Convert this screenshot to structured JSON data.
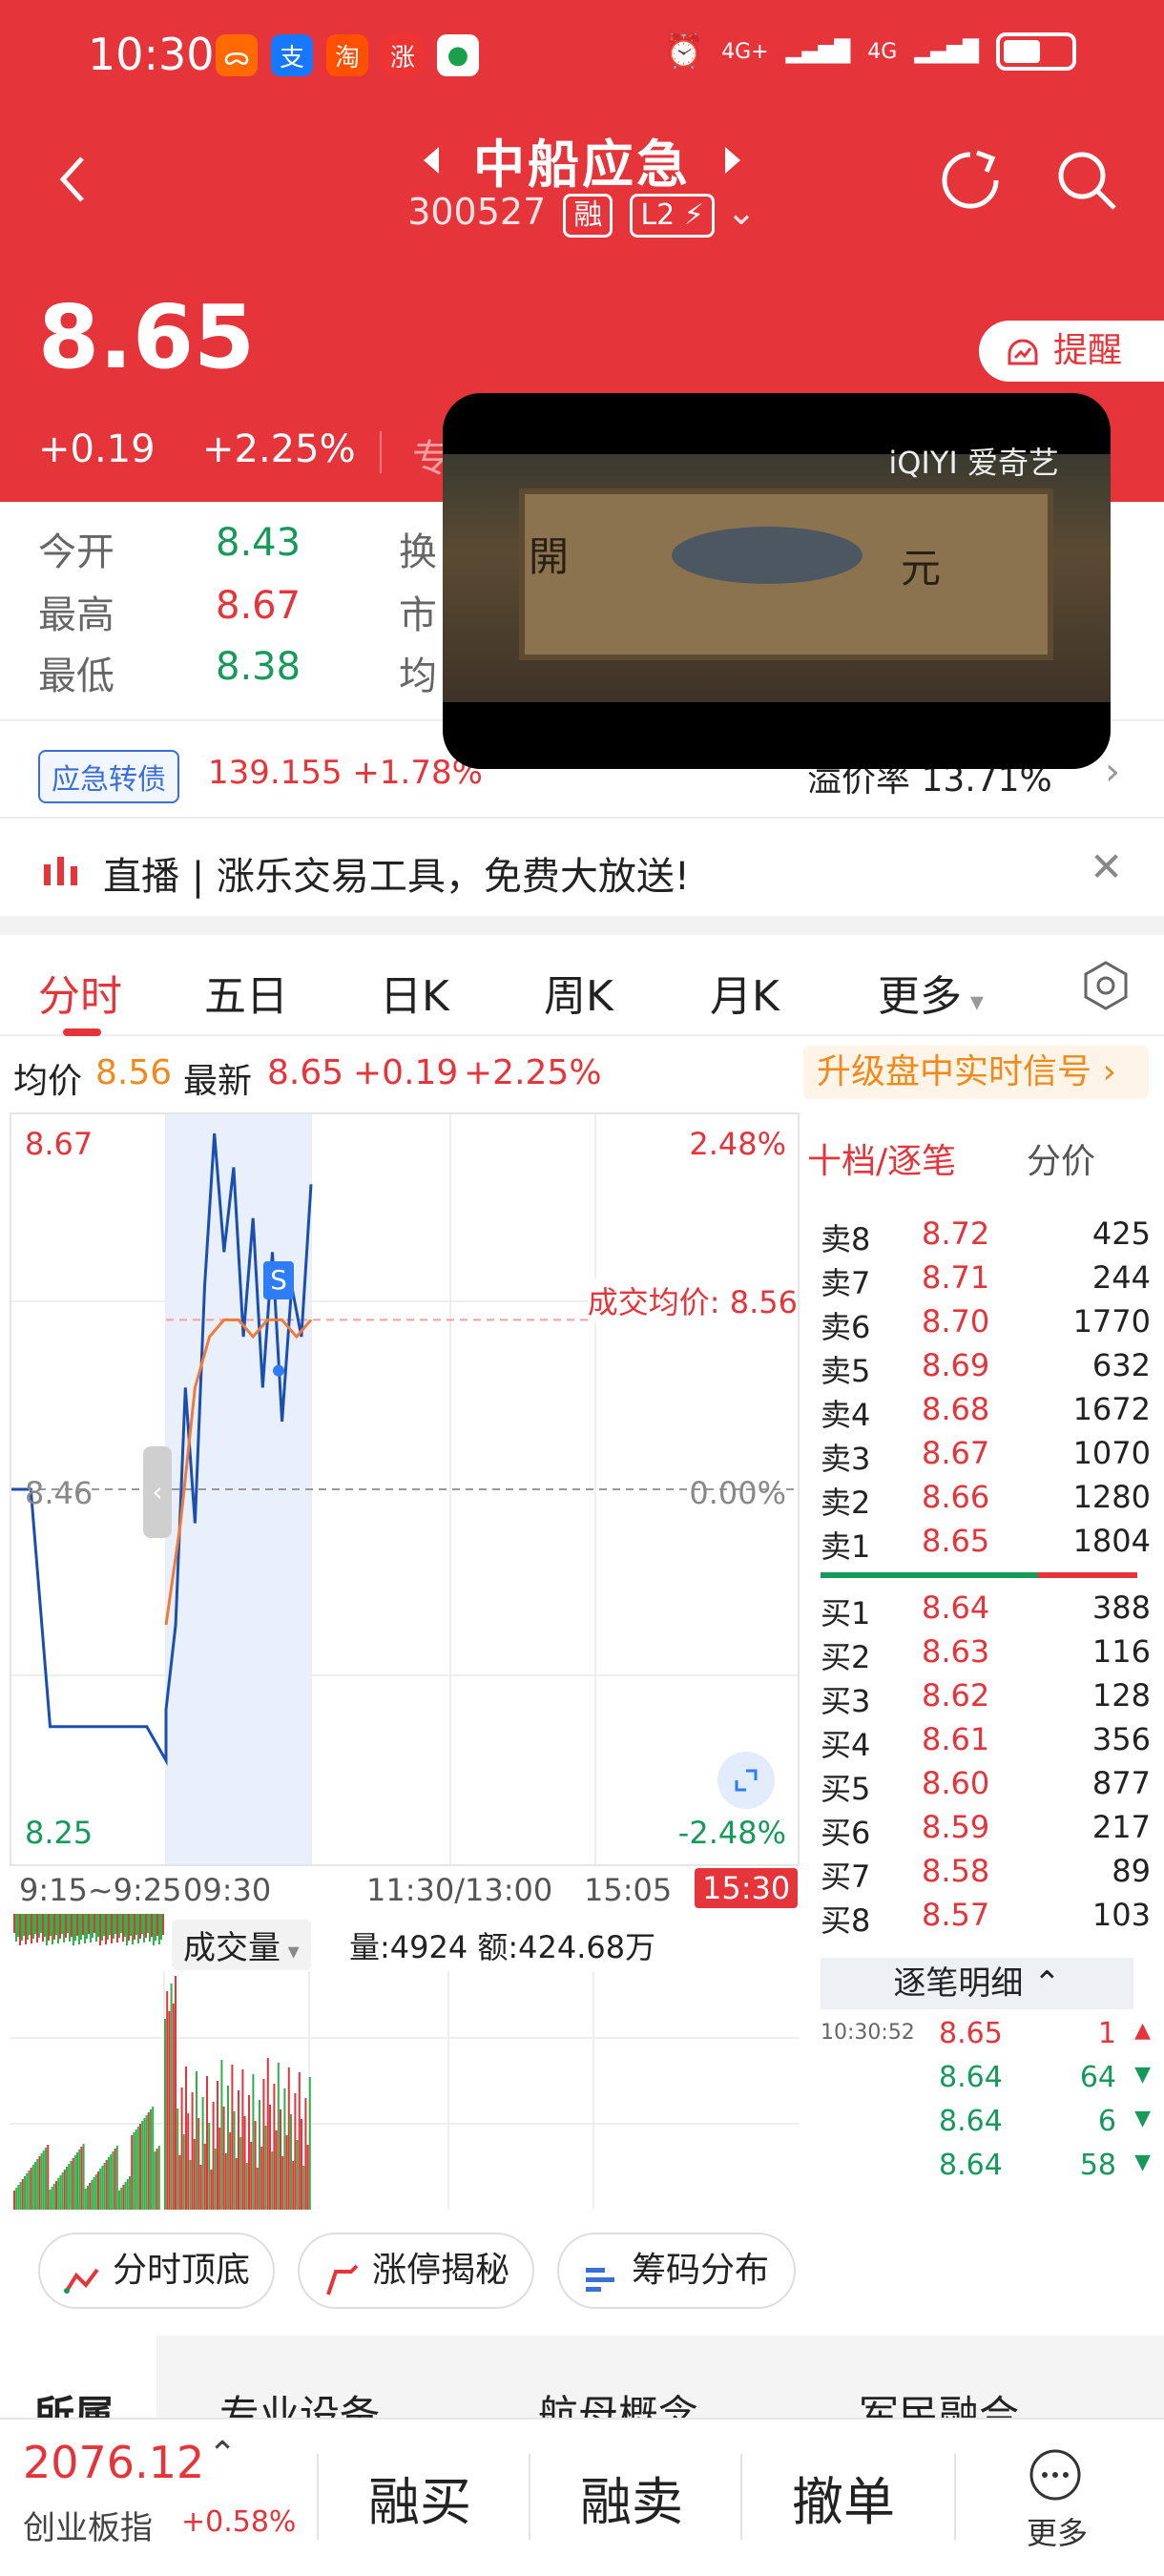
{
  "status_bar": {
    "time": "10:30",
    "net1": "4G+",
    "net2": "4G",
    "apps": [
      "app-a",
      "支",
      "淘",
      "涨",
      "app-e"
    ]
  },
  "header": {
    "title": "中船应急",
    "code": "300527",
    "tag_margin": "融",
    "tag_level": "L2",
    "price": "8.65",
    "change": "+0.19",
    "change_pct": "+2.25%",
    "partial_text": "专",
    "remind_label": "提醒"
  },
  "stats": {
    "open_label": "今开",
    "open": "8.43",
    "high_label": "最高",
    "high": "8.67",
    "low_label": "最低",
    "low": "8.38",
    "col2_1": "换",
    "col2_2": "市",
    "col2_3": "均"
  },
  "bond": {
    "tag": "应急转债",
    "price": "139.155",
    "pct": "+1.78%",
    "premium": "溢价率 13.71%"
  },
  "live_banner": {
    "text": "直播 | 涨乐交易工具，免费大放送!"
  },
  "video_overlay": {
    "brand": "iQIYI 爱奇艺",
    "chars": [
      "開",
      "元"
    ]
  },
  "chart_tabs": [
    "分时",
    "五日",
    "日K",
    "周K",
    "月K",
    "更多"
  ],
  "chart_info": {
    "avg_label": "均价",
    "avg": "8.56",
    "latest_label": "最新",
    "latest": "8.65",
    "chg": "+0.19",
    "chg_pct": "+2.25%",
    "upgrade": "升级盘中实时信号",
    "top_price": "8.67",
    "top_pct": "2.48%",
    "mid_price": "8.46",
    "mid_pct": "0.00%",
    "bot_price": "8.25",
    "bot_pct": "-2.48%",
    "avg_annot": "成交均价: 8.56",
    "signal": "S",
    "times": [
      "9:15~9:25",
      "09:30",
      "11:30/13:00",
      "15:05",
      "15:30"
    ],
    "vol_label": "成交量",
    "vol_text": "量:4924 额:424.68万"
  },
  "chart_data": {
    "type": "line",
    "ylim": [
      8.25,
      8.67
    ],
    "series": [
      {
        "values": [
          8.46,
          8.46,
          8.32,
          8.32,
          8.32,
          8.32,
          8.32,
          8.32,
          8.3,
          8.33,
          8.38,
          8.52,
          8.44,
          8.58,
          8.67,
          8.6,
          8.65,
          8.55,
          8.62,
          8.52,
          8.6,
          8.5,
          8.58,
          8.55,
          8.64
        ]
      },
      {
        "values": [
          8.38,
          8.44,
          8.52,
          8.55,
          8.56,
          8.56,
          8.55,
          8.56,
          8.56,
          8.55,
          8.56
        ]
      }
    ]
  },
  "order_book": {
    "header_left": "十档/逐笔",
    "header_right": "分价",
    "asks": [
      {
        "k": "卖8",
        "p": "8.72",
        "v": "425"
      },
      {
        "k": "卖7",
        "p": "8.71",
        "v": "244"
      },
      {
        "k": "卖6",
        "p": "8.70",
        "v": "1770"
      },
      {
        "k": "卖5",
        "p": "8.69",
        "v": "632"
      },
      {
        "k": "卖4",
        "p": "8.68",
        "v": "1672"
      },
      {
        "k": "卖3",
        "p": "8.67",
        "v": "1070"
      },
      {
        "k": "卖2",
        "p": "8.66",
        "v": "1280"
      },
      {
        "k": "卖1",
        "p": "8.65",
        "v": "1804"
      }
    ],
    "bids": [
      {
        "k": "买1",
        "p": "8.64",
        "v": "388"
      },
      {
        "k": "买2",
        "p": "8.63",
        "v": "116"
      },
      {
        "k": "买3",
        "p": "8.62",
        "v": "128"
      },
      {
        "k": "买4",
        "p": "8.61",
        "v": "356"
      },
      {
        "k": "买5",
        "p": "8.60",
        "v": "877"
      },
      {
        "k": "买6",
        "p": "8.59",
        "v": "217"
      },
      {
        "k": "买7",
        "p": "8.58",
        "v": "89"
      },
      {
        "k": "买8",
        "p": "8.57",
        "v": "103"
      }
    ],
    "ticks_label": "逐笔明细",
    "ticks": [
      {
        "t": "10:30:52",
        "p": "8.65",
        "v": "1",
        "dir": "up"
      },
      {
        "t": "",
        "p": "8.64",
        "v": "64",
        "dir": "down"
      },
      {
        "t": "",
        "p": "8.64",
        "v": "6",
        "dir": "down"
      },
      {
        "t": "",
        "p": "8.64",
        "v": "58",
        "dir": "down"
      }
    ]
  },
  "tool_buttons": [
    "分时顶底",
    "涨停揭秘",
    "筹码分布"
  ],
  "concepts": [
    "所属",
    "专业设备",
    "航母概念",
    "军民融合"
  ],
  "bottom": {
    "index_value": "2076.12",
    "index_name": "创业板指",
    "index_pct": "+0.58%",
    "buy": "融买",
    "sell": "融卖",
    "cancel": "撤单",
    "more": "更多"
  },
  "colors": {
    "brand_red": "#e5343a",
    "up": "#e5343a",
    "down": "#159a5a"
  }
}
